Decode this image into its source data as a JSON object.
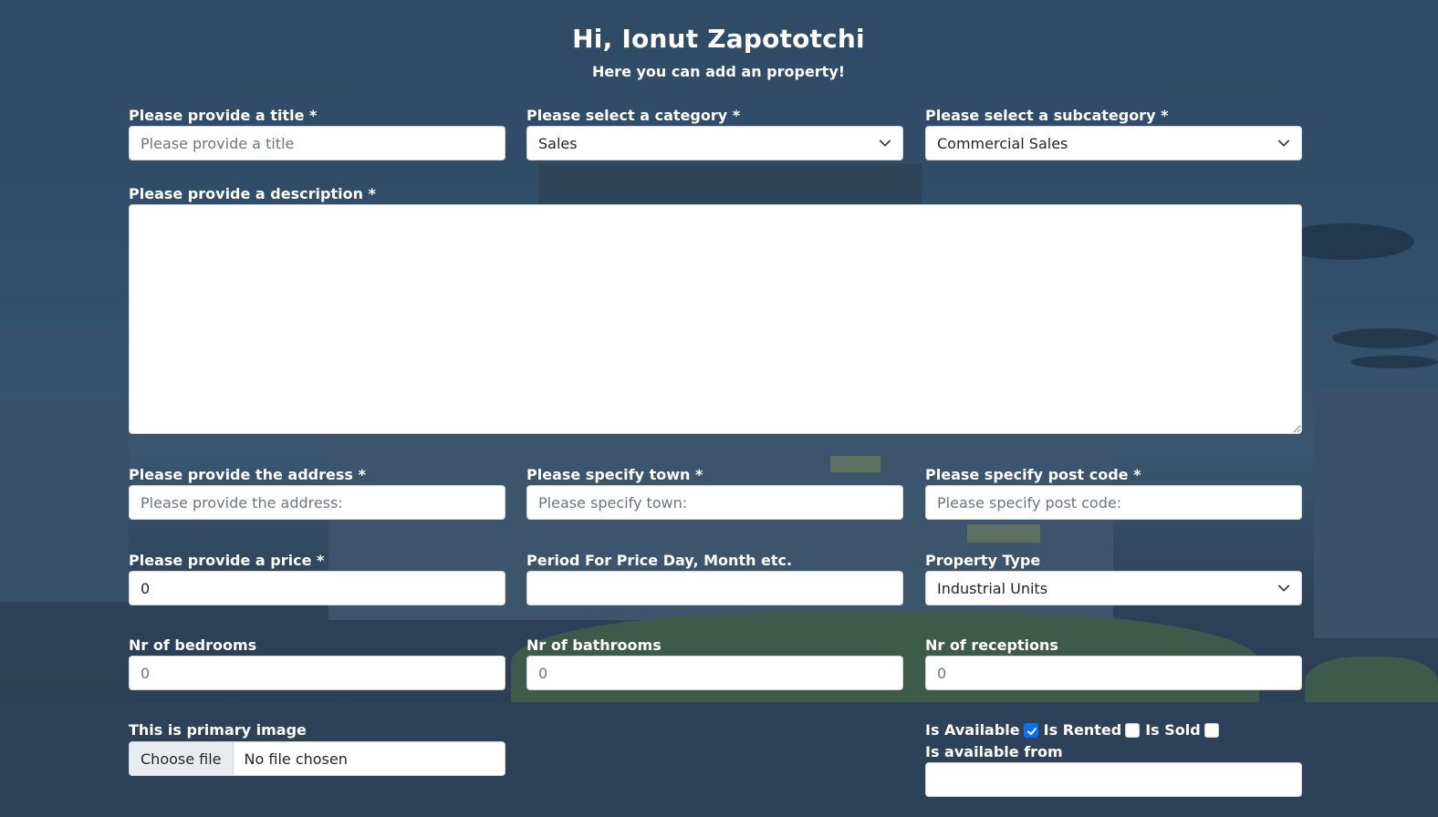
{
  "header": {
    "greeting": "Hi, Ionut Zapototchi",
    "subtitle": "Here you can add an property!"
  },
  "form": {
    "title": {
      "label": "Please provide a title *",
      "placeholder": "Please provide a title",
      "value": ""
    },
    "category": {
      "label": "Please select a category *",
      "selected": "Sales"
    },
    "subcategory": {
      "label": "Please select a subcategory *",
      "selected": "Commercial Sales"
    },
    "description": {
      "label": "Please provide a description *",
      "value": ""
    },
    "address": {
      "label": "Please provide the address *",
      "placeholder": "Please provide the address:",
      "value": ""
    },
    "town": {
      "label": "Please specify town *",
      "placeholder": "Please specify town:",
      "value": ""
    },
    "postcode": {
      "label": "Please specify post code *",
      "placeholder": "Please specify post code:",
      "value": ""
    },
    "price": {
      "label": "Please provide a price *",
      "value": "0"
    },
    "period": {
      "label": "Period For Price Day, Month etc.",
      "value": ""
    },
    "property_type": {
      "label": "Property Type",
      "selected": "Industrial Units"
    },
    "bedrooms": {
      "label": "Nr of bedrooms",
      "placeholder": "0"
    },
    "bathrooms": {
      "label": "Nr of bathrooms",
      "placeholder": "0"
    },
    "receptions": {
      "label": "Nr of receptions",
      "placeholder": "0"
    },
    "primary_image": {
      "label": "This is primary image",
      "button": "Choose file",
      "status": "No file chosen"
    },
    "status_checks": {
      "is_available": {
        "label": "Is Available",
        "checked": true
      },
      "is_rented": {
        "label": "Is Rented",
        "checked": false
      },
      "is_sold": {
        "label": "Is Sold",
        "checked": false
      }
    },
    "available_from": {
      "label": "Is available from",
      "value": ""
    }
  },
  "colors": {
    "overlay": "#2f4b66",
    "checkbox_on": "#0d6efd",
    "field_bg": "#ffffff",
    "placeholder": "#6c757d"
  },
  "icons": {
    "select_arrow": "chevron-down-icon",
    "checkbox_mark": "check-icon"
  }
}
